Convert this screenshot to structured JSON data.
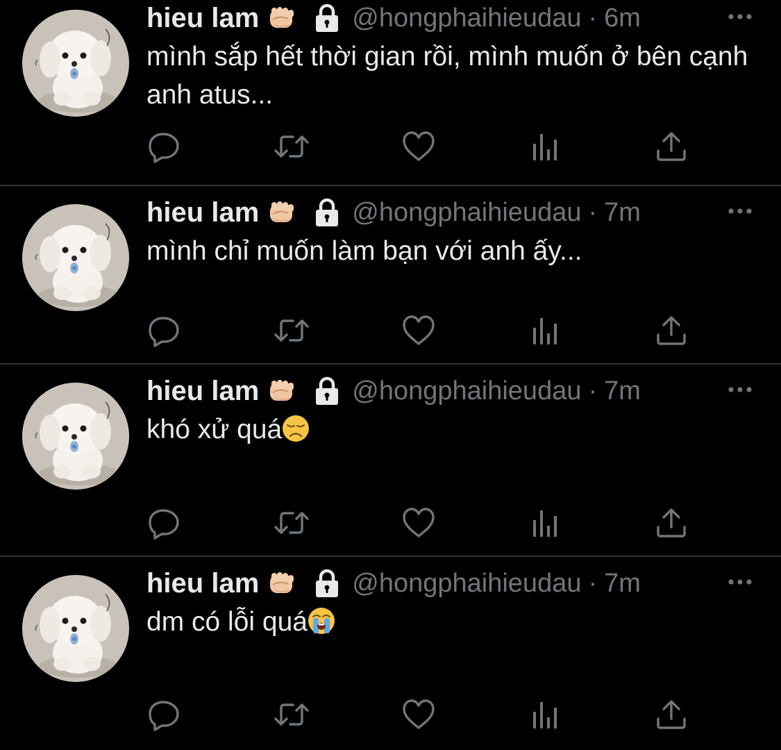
{
  "colors": {
    "background": "#000000",
    "text_primary": "#e7e9ea",
    "text_secondary": "#71767b",
    "divider": "#2f3336",
    "icon": "#71767b"
  },
  "tweets": [
    {
      "author_name": "hieu lam",
      "author_badges": [
        "fist-emoji",
        "lock-icon"
      ],
      "handle": "@hongphaihieudau",
      "separator": "·",
      "time": "6m",
      "text": "mình sắp hết thời gian rồi, mình muốn ở bên cạnh anh atus...",
      "emoji": null
    },
    {
      "author_name": "hieu lam",
      "author_badges": [
        "fist-emoji",
        "lock-icon"
      ],
      "handle": "@hongphaihieudau",
      "separator": "·",
      "time": "7m",
      "text": "mình chỉ muốn làm bạn với anh ấy...",
      "emoji": null
    },
    {
      "author_name": "hieu lam",
      "author_badges": [
        "fist-emoji",
        "lock-icon"
      ],
      "handle": "@hongphaihieudau",
      "separator": "·",
      "time": "7m",
      "text": "khó xử quá",
      "emoji": "disappointed-face"
    },
    {
      "author_name": "hieu lam",
      "author_badges": [
        "fist-emoji",
        "lock-icon"
      ],
      "handle": "@hongphaihieudau",
      "separator": "·",
      "time": "7m",
      "text": "dm có lỗi quá",
      "emoji": "crying-face"
    }
  ],
  "action_icons": [
    "reply-icon",
    "retweet-icon",
    "like-icon",
    "views-icon",
    "share-icon"
  ],
  "menu_icon": "more-options-icon"
}
